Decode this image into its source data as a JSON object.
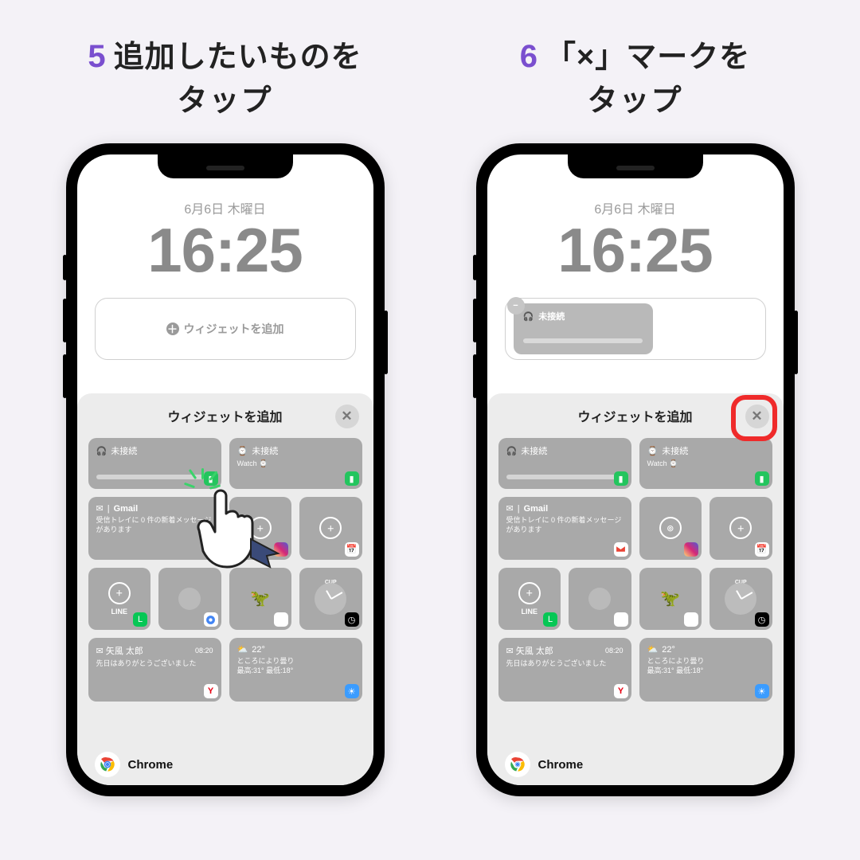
{
  "steps": [
    {
      "num": "5",
      "line1": "追加したいものを",
      "line2": "タップ"
    },
    {
      "num": "6",
      "line1": "「×」マークを",
      "line2": "タップ"
    }
  ],
  "lock": {
    "date": "6月6日 木曜日",
    "time": "16:25",
    "add_widget_label": "ウィジェットを追加"
  },
  "placed_widget": {
    "title": "未接続"
  },
  "sheet": {
    "title": "ウィジェットを追加",
    "close_glyph": "✕",
    "widgets": {
      "battery1": {
        "title": "未接続"
      },
      "battery2": {
        "title": "未接続",
        "sub": "Watch"
      },
      "gmail": {
        "title": "Gmail",
        "sub": "受信トレイに 0 件の新着メッセージがあります"
      },
      "line_label": "LINE",
      "mail_card": {
        "from": "矢風 太郎",
        "time": "08:20",
        "body": "先日はありがとうございました"
      },
      "weather": {
        "temp": "22°",
        "line1": "ところにより曇り",
        "line2": "最高:31° 最低:18°"
      },
      "cup_label": "CUP"
    }
  },
  "chrome_label": "Chrome"
}
